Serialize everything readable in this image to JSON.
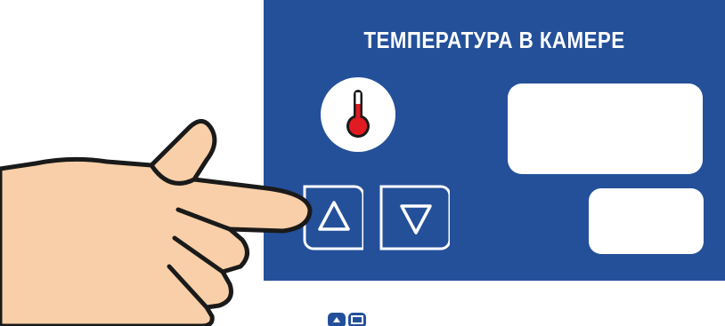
{
  "panel": {
    "title": "ТЕМПЕРАТУРА В КАМЕРЕ",
    "background_color": "#24509a",
    "icon": "thermometer-icon",
    "thermometer_fill_color": "#e11b22",
    "display_main_value": "",
    "display_small_value": ""
  },
  "buttons": {
    "up": {
      "icon": "triangle-up-icon"
    },
    "down": {
      "icon": "triangle-down-icon"
    }
  },
  "overlay": {
    "hand_icon": "pointing-hand-icon",
    "hand_color": "#f8cfa8"
  }
}
